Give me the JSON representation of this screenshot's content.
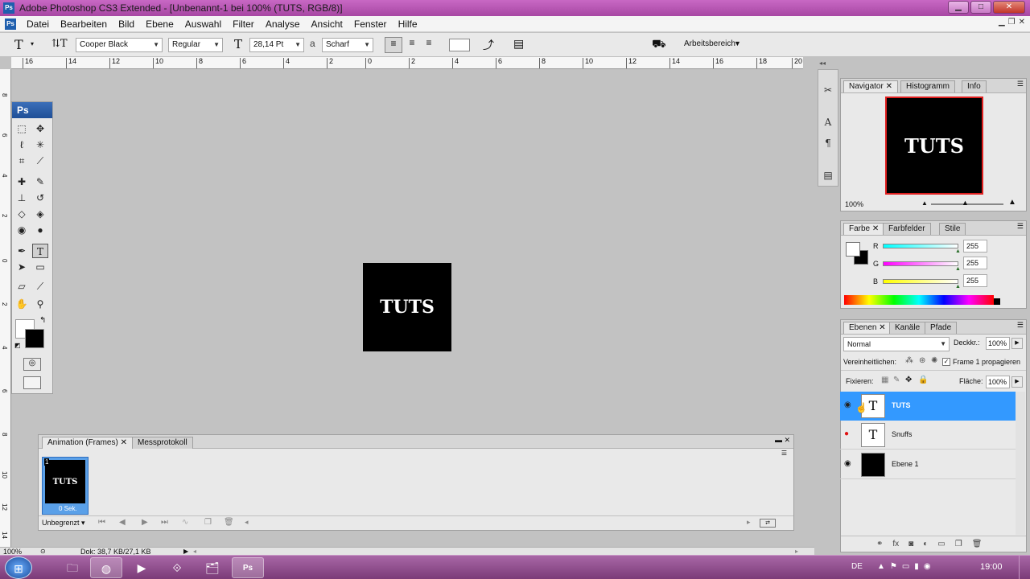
{
  "app": {
    "title": "Adobe Photoshop CS3 Extended - [Unbenannt-1 bei 100% (TUTS, RGB/8)]",
    "logo": "Ps"
  },
  "menu": [
    "Datei",
    "Bearbeiten",
    "Bild",
    "Ebene",
    "Auswahl",
    "Filter",
    "Analyse",
    "Ansicht",
    "Fenster",
    "Hilfe"
  ],
  "options": {
    "font_family": "Cooper Black",
    "font_style": "Regular",
    "font_size": "28,14 Pt",
    "aa_label": "a",
    "antialias": "Scharf",
    "workspace": "Arbeitsbereich"
  },
  "ruler_h": [
    "16",
    "14",
    "12",
    "10",
    "8",
    "6",
    "4",
    "2",
    "0",
    "2",
    "4",
    "6",
    "8",
    "10",
    "12",
    "14",
    "16",
    "18",
    "20"
  ],
  "ruler_v": [
    "8",
    "6",
    "4",
    "2",
    "0",
    "2",
    "4",
    "6",
    "8",
    "10",
    "12",
    "14",
    "16",
    "18"
  ],
  "document": {
    "text": "TUTS"
  },
  "toolbox": {
    "title": "Ps"
  },
  "animation": {
    "tab1": "Animation (Frames)",
    "tab2": "Messprotokoll",
    "frame_num": "1",
    "frame_text": "TUTS",
    "frame_delay": "0 Sek.",
    "loop": "Unbegrenzt"
  },
  "status": {
    "zoom": "100%",
    "doc": "Dok: 38,7 KB/27,1 KB"
  },
  "navigator": {
    "tabs": [
      "Navigator",
      "Histogramm",
      "Info"
    ],
    "preview_text": "TUTS",
    "zoom": "100%"
  },
  "color": {
    "tabs": [
      "Farbe",
      "Farbfelder",
      "Stile"
    ],
    "r_label": "R",
    "g_label": "G",
    "b_label": "B",
    "r": "255",
    "g": "255",
    "b": "255"
  },
  "layers": {
    "tabs": [
      "Ebenen",
      "Kanäle",
      "Pfade"
    ],
    "blend": "Normal",
    "opacity_label": "Deckkr.:",
    "opacity": "100%",
    "unify_label": "Vereinheitlichen:",
    "propagate": "Frame 1 propagieren",
    "lock_label": "Fixieren:",
    "fill_label": "Fläche:",
    "fill": "100%",
    "items": [
      {
        "name": "TUTS",
        "thumb": "T"
      },
      {
        "name": "Snuffs",
        "thumb": "T"
      },
      {
        "name": "Ebene 1",
        "thumb": ""
      }
    ]
  },
  "taskbar": {
    "lang": "DE",
    "time": "19:00"
  }
}
